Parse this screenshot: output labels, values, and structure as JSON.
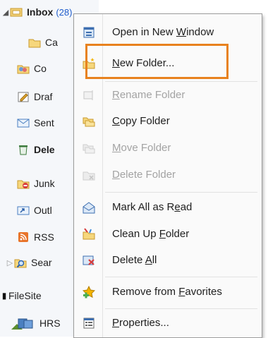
{
  "folder_pane": {
    "items": [
      {
        "label": "Inbox",
        "count": "(28)",
        "bold": true,
        "icon": "inbox-folder-icon"
      },
      {
        "label": "Ca",
        "icon": "folder-icon"
      },
      {
        "label": "Co",
        "icon": "contacts-folder-icon"
      },
      {
        "label": "Draf",
        "icon": "drafts-folder-icon"
      },
      {
        "label": "Sent",
        "icon": "sent-folder-icon"
      },
      {
        "label": "Dele",
        "bold": true,
        "icon": "deleted-items-icon"
      },
      {
        "label": "Junk",
        "icon": "junk-folder-icon"
      },
      {
        "label": "Outl",
        "icon": "outbox-folder-icon"
      },
      {
        "label": "RSS",
        "icon": "rss-folder-icon"
      },
      {
        "label": "Sear",
        "icon": "search-folder-icon"
      },
      {
        "label": "FileSite",
        "icon": "filesite-icon"
      },
      {
        "label": "HRS",
        "icon": "hrs-store-icon"
      }
    ]
  },
  "context_menu": {
    "items": [
      {
        "pre": "Open in New ",
        "ul": "W",
        "post": "indow",
        "icon": "open-new-window-icon",
        "enabled": true
      },
      {
        "pre": "",
        "ul": "N",
        "post": "ew Folder...",
        "icon": "new-folder-icon",
        "enabled": true,
        "highlighted": true
      },
      {
        "pre": "",
        "ul": "R",
        "post": "ename Folder",
        "icon": "rename-folder-icon",
        "enabled": false
      },
      {
        "pre": "",
        "ul": "C",
        "post": "opy Folder",
        "icon": "copy-folder-icon",
        "enabled": true
      },
      {
        "pre": "",
        "ul": "M",
        "post": "ove Folder",
        "icon": "move-folder-icon",
        "enabled": false
      },
      {
        "pre": "",
        "ul": "D",
        "post": "elete Folder",
        "icon": "delete-folder-icon",
        "enabled": false
      },
      {
        "pre": "Mark All as R",
        "ul": "e",
        "post": "ad",
        "icon": "mark-all-read-icon",
        "enabled": true
      },
      {
        "pre": "Clean Up ",
        "ul": "F",
        "post": "older",
        "icon": "clean-up-folder-icon",
        "enabled": true
      },
      {
        "pre": "Delete ",
        "ul": "A",
        "post": "ll",
        "icon": "delete-all-icon",
        "enabled": true
      },
      {
        "pre": "Remove from ",
        "ul": "F",
        "post": "avorites",
        "icon": "remove-favorites-icon",
        "enabled": true
      },
      {
        "pre": "",
        "ul": "P",
        "post": "roperties...",
        "icon": "properties-icon",
        "enabled": true
      }
    ]
  },
  "colors": {
    "highlight_box": "#e8821e",
    "menu_bg": "#fafafa",
    "disabled_text": "#a3a3a3"
  }
}
